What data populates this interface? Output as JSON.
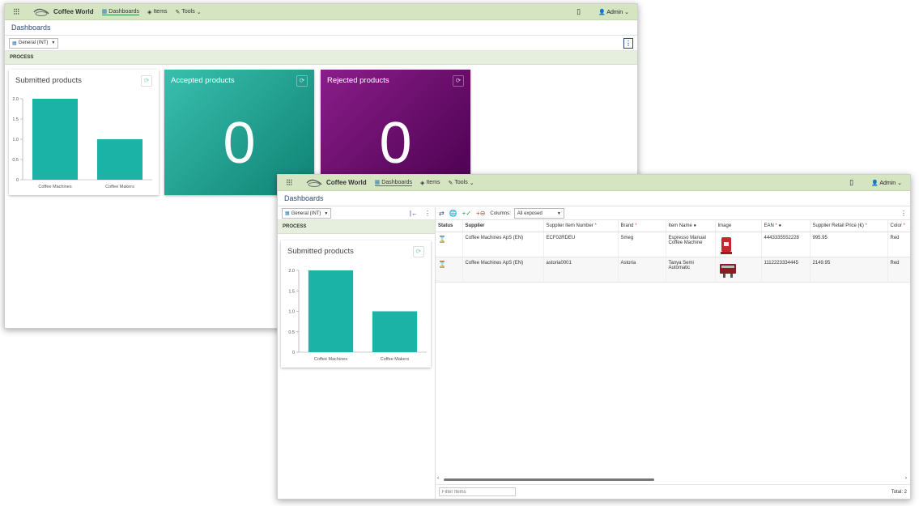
{
  "app": {
    "brand": "Coffee World",
    "nav": {
      "dashboards": "Dashboards",
      "items": "Items",
      "tools": "Tools"
    },
    "user": "Admin",
    "page_title": "Dashboards",
    "view_select": "General (INT)",
    "section": "PROCESS"
  },
  "cards": {
    "submitted_title": "Submitted products",
    "accepted_title": "Accepted products",
    "accepted_value": "0",
    "rejected_title": "Rejected products",
    "rejected_value": "0"
  },
  "chart_data": {
    "type": "bar",
    "title": "Submitted products",
    "categories": [
      "Coffee Machines",
      "Coffee Makers"
    ],
    "values": [
      2,
      1
    ],
    "yticks": [
      "0",
      "0.5",
      "1.0",
      "1.5",
      "2.0"
    ],
    "ylim": [
      0,
      2
    ],
    "color": "#1ab3a6"
  },
  "grid": {
    "columns_label": "Columns:",
    "columns_value": "All exposed",
    "headers": [
      "Status",
      "Supplier",
      "Supplier Item Number",
      "Brand",
      "Item Name",
      "Image",
      "EAN",
      "Supplier Retail Price (€)",
      "Color"
    ],
    "rows": [
      {
        "supplier": "Coffee Machines ApS (EN)",
        "item_number": "ECF02RDEU",
        "brand": "Smeg",
        "item_name": "Espresso Manual Coffee Machine",
        "ean": "4443335552228",
        "price": "995.95",
        "color": "Red"
      },
      {
        "supplier": "Coffee Machines ApS (EN)",
        "item_number": "astoria0001",
        "brand": "Astoria",
        "item_name": "Tanya Semi Automatic",
        "ean": "1112223334445",
        "price": "2149.95",
        "color": "Red"
      }
    ],
    "filter_placeholder": "Filter Items",
    "total": "Total: 2"
  },
  "icons": {
    "apps": "apps-grid-icon",
    "dashboard": "dashboard-icon",
    "items": "items-icon",
    "tools": "wrench-icon",
    "clipboard": "clipboard-icon",
    "user": "user-icon",
    "refresh": "refresh-icon",
    "status": "hourglass-icon"
  },
  "colors": {
    "topbar": "#d5e5c2",
    "accent_teal": "#1ab3a6",
    "card_green": "#26a393",
    "card_purple": "#6a0f6e",
    "status_pending": "#e69a1e",
    "required": "#e53b3b"
  }
}
